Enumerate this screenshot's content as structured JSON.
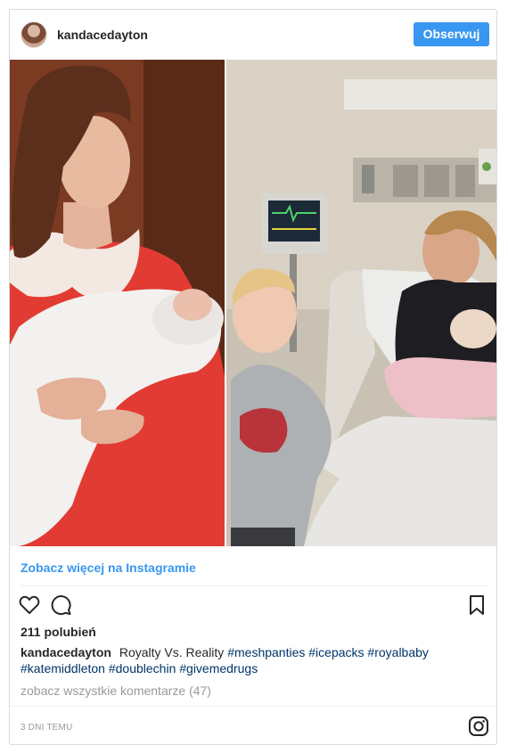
{
  "header": {
    "username": "kandacedayton",
    "follow_label": "Obserwuj"
  },
  "post": {
    "more_link": "Zobacz więcej na Instagramie",
    "likes": "211 polubień",
    "caption_user": "kandacedayton",
    "caption_text": "Royalty Vs. Reality",
    "hashtags": [
      "#meshpanties",
      "#icepacks",
      "#royalbaby",
      "#katemiddleton",
      "#doublechin",
      "#givemedrugs"
    ],
    "comments_link": "zobacz wszystkie komentarze (47)",
    "timestamp": "3 DNI TEMU"
  },
  "icons": {
    "like": "heart-icon",
    "comment": "comment-icon",
    "save": "bookmark-icon",
    "brand": "instagram-icon"
  },
  "colors": {
    "accent": "#3897f0",
    "hashtag": "#003569",
    "muted": "#999999"
  }
}
